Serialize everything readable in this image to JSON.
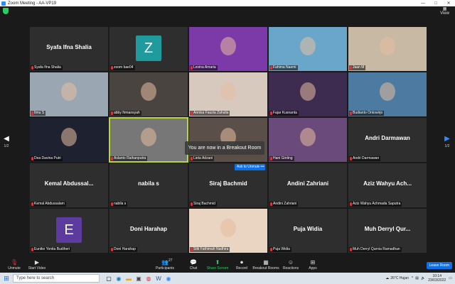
{
  "window": {
    "title": "Zoom Meeting - AA-VP19",
    "controls": [
      "—",
      "□",
      "✕"
    ]
  },
  "topbar": {
    "view_label": "View"
  },
  "pager": {
    "prev_page": "1/2",
    "next_page": "1/2"
  },
  "tiles": [
    {
      "name": "Syafa Ifna Shalia",
      "label": "Syafa Ifna Shalia",
      "type": "name"
    },
    {
      "name": "zoom bae04",
      "type": "avatar",
      "letter": "Z",
      "color": "#1f9b9e"
    },
    {
      "name": "Levina Amaria",
      "type": "video",
      "bg": "#7b3aa8"
    },
    {
      "name": "Fahima Naemi",
      "type": "video",
      "bg": "#6aa6c9"
    },
    {
      "name": "Jaan M",
      "type": "video",
      "bg": "#c7b9a4"
    },
    {
      "name": "Ilmu S",
      "type": "video",
      "bg": "#9aa7b3"
    },
    {
      "name": "abby firmansyah",
      "type": "video",
      "bg": "#4a4440"
    },
    {
      "name": "Annisa Fauzia Zahalia",
      "type": "video",
      "bg": "#d8c9bf"
    },
    {
      "name": "Fajar Kusnanta",
      "type": "video",
      "bg": "#3d2c4f"
    },
    {
      "name": "Budianto Ontowirjo",
      "type": "video",
      "bg": "#4d7aa0"
    },
    {
      "name": "Dea Davina Putri",
      "type": "video",
      "bg": "#1e2230"
    },
    {
      "name": "Aslanto Raihanputra",
      "type": "video",
      "bg": "#777777",
      "active": true
    },
    {
      "name": "Lieta Adzani",
      "type": "video",
      "bg": "#5a5049"
    },
    {
      "name": "Hani Ginting",
      "type": "video",
      "bg": "#6a4a7a"
    },
    {
      "name": "Andri Darmawan",
      "label": "Andri Darmawan",
      "type": "name"
    },
    {
      "name": "Kemal Abdussalam",
      "label": "Kemal  Abdussal...",
      "type": "name"
    },
    {
      "name": "nabila s",
      "label": "nabila s",
      "type": "name"
    },
    {
      "name": "Siraj Bachmid",
      "label": "Siraj Bachmid",
      "type": "name"
    },
    {
      "name": "Andini Zahriani",
      "label": "Andini Zahriani",
      "type": "name"
    },
    {
      "name": "Aziz Wahyu Achmada Saputra",
      "label": "Aziz  Wahyu  Ach...",
      "type": "name"
    },
    {
      "name": "Eunike Yonita Budiheri",
      "type": "avatar",
      "letter": "E",
      "color": "#5c3a9e"
    },
    {
      "name": "Doni Harahap",
      "label": "Doni Harahap",
      "type": "name"
    },
    {
      "name": "Sitti Fathimah Nadhira",
      "type": "video",
      "bg": "#e9d5c2"
    },
    {
      "name": "Puja Widia",
      "label": "Puja Widia",
      "type": "name"
    },
    {
      "name": "Muh Derryl Qurnia Ramadhan",
      "label": "Muh  Derryl  Qur...",
      "type": "name"
    }
  ],
  "breakout_notice": "You are now in a Breakout Room",
  "ask_for_help": "Ask to Unmute",
  "ask_more": "•••",
  "toolbar": {
    "unmute": "Unmute",
    "start_video": "Start Video",
    "participants": "Participants",
    "participants_count": "27",
    "chat": "Chat",
    "share_screen": "Share Screen",
    "record": "Record",
    "breakout_rooms": "Breakout Rooms",
    "reactions": "Reactions",
    "apps": "Apps",
    "leave_room": "Leave Room"
  },
  "taskbar": {
    "search_placeholder": "Type here to search",
    "weather": "26°C  Hujan",
    "time": "10:14",
    "date": "23/03/2022"
  }
}
